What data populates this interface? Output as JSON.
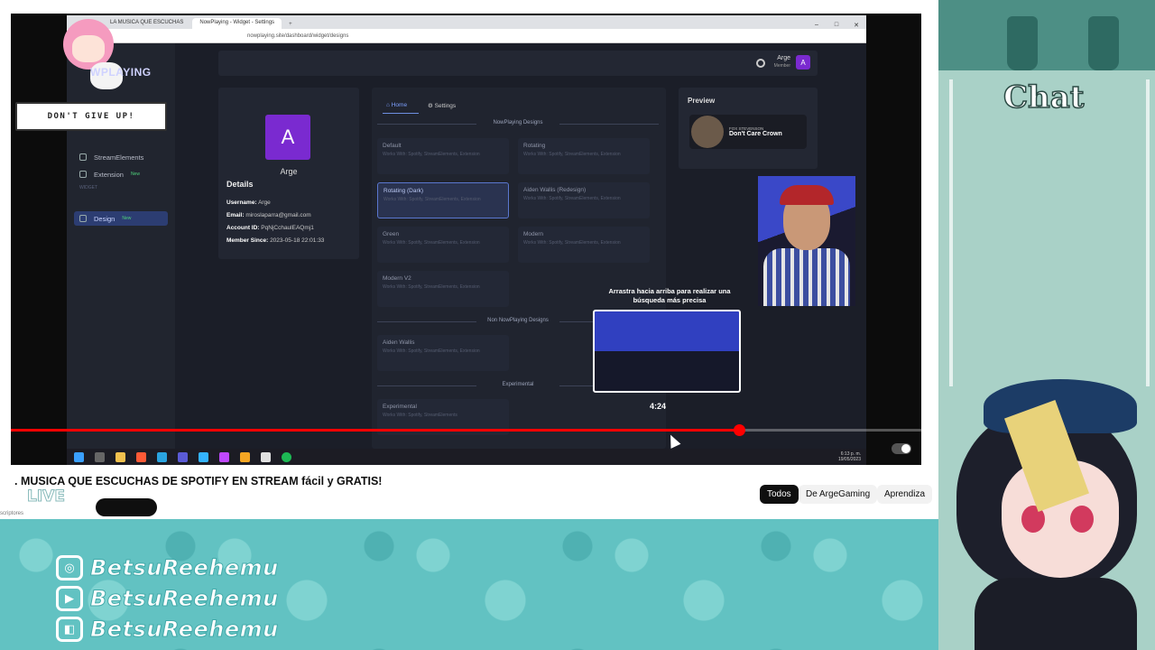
{
  "browser": {
    "tabs": [
      "LA MUSICA QUE ESCUCHAS",
      "NowPlaying - Widget - Settings"
    ],
    "new_tab": "+",
    "url": "nowplaying.site/dashboard/widget/designs"
  },
  "app": {
    "logo": "WPLAYING",
    "sidebar": [
      {
        "label": "StreamElements",
        "badge": ""
      },
      {
        "label": "Extension",
        "badge": "New"
      },
      {
        "label": "Design",
        "badge": "New"
      }
    ],
    "sidebar_section": "Widget",
    "user": {
      "name": "Arge",
      "role": "Member",
      "initial": "A"
    },
    "profile": {
      "initial": "A",
      "name": "Arge",
      "details_heading": "Details",
      "rows": [
        {
          "label": "Username:",
          "value": "Arge"
        },
        {
          "label": "Email:",
          "value": "miroslaparra@gmail.com"
        },
        {
          "label": "Account ID:",
          "value": "PqNjCchaulEAQmj1"
        },
        {
          "label": "Member Since:",
          "value": "2023-05-18 22:01:33"
        }
      ]
    },
    "design_tabs": {
      "home": "Home",
      "settings": "Settings"
    },
    "sections": {
      "nowplaying": "NowPlaying Designs",
      "non_nowplaying": "Non NowPlaying Designs",
      "experimental": "Experimental"
    },
    "cards": [
      {
        "title": "Default",
        "sub": "Works With: Spotify, StreamElements, Extension"
      },
      {
        "title": "Rotating",
        "sub": "Works With: Spotify, StreamElements, Extension"
      },
      {
        "title": "Rotating (Dark)",
        "sub": "Works With: Spotify, StreamElements, Extension"
      },
      {
        "title": "Aiden Wallis (Redesign)",
        "sub": "Works With: Spotify, StreamElements, Extension"
      },
      {
        "title": "Green",
        "sub": "Works With: Spotify, StreamElements, Extension"
      },
      {
        "title": "Modern",
        "sub": "Works With: Spotify, StreamElements, Extension"
      },
      {
        "title": "Modern V2",
        "sub": "Works With: Spotify, StreamElements, Extension"
      },
      {
        "title": "Aiden Wallis",
        "sub": "Works With: Spotify, StreamElements, Extension"
      },
      {
        "title": "Experimental",
        "sub": "Works With: Spotify, StreamElements"
      }
    ],
    "preview": {
      "heading": "Preview",
      "artist": "FOX STEVENSON",
      "song": "Don't Care Crown"
    }
  },
  "player": {
    "scrub_hint": "Arrastra hacia arriba para realizar una búsqueda más precisa",
    "scrub_time": "4:24",
    "progress_fraction": 0.8,
    "clock_time": "6:13 p. m.",
    "clock_date": "19/05/2023"
  },
  "stream": {
    "sticker_text": "DON'T GIVE UP!",
    "chat_title": "Chat",
    "live_label": "LIVE",
    "socials": [
      {
        "icon": "instagram-icon",
        "glyph": "◎",
        "name": "BetsuReehemu"
      },
      {
        "icon": "youtube-icon",
        "glyph": "▶",
        "name": "BetsuReehemu"
      },
      {
        "icon": "twitch-icon",
        "glyph": "◧",
        "name": "BetsuReehemu"
      }
    ]
  },
  "youtube": {
    "title": ". MUSICA QUE ESCUCHAS DE SPOTIFY EN STREAM fácil y GRATIS!",
    "subs_text": "scriptores",
    "chips": [
      "Todos",
      "De ArgeGaming",
      "Aprendiza"
    ]
  },
  "colors": {
    "accent": "#ff0000",
    "purple": "#7a2ad0",
    "teal": "#62c2c2"
  }
}
